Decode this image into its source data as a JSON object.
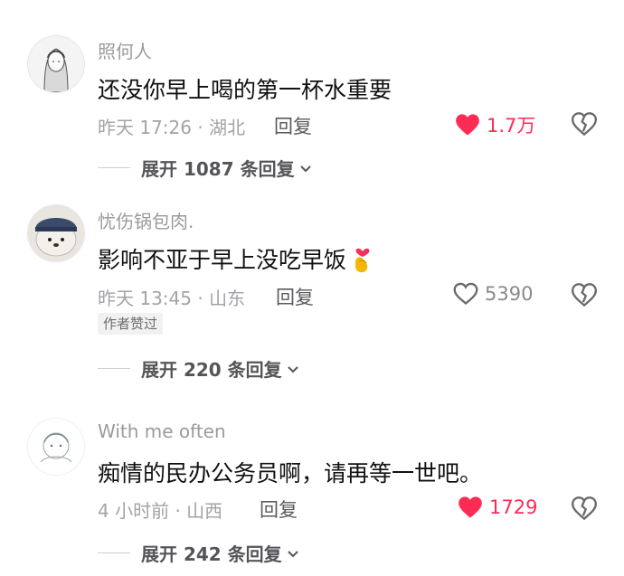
{
  "comments": [
    {
      "username": "照何人",
      "content": "还没你早上喝的第一杯水重要",
      "meta": "昨天 17:26 · 湖北",
      "reply_label": "回复",
      "likes": "1.7万",
      "liked": true,
      "expand": "展开 1087 条回复"
    },
    {
      "username": "忧伤锅包肉.",
      "content": "影响不亚于早上没吃早饭",
      "meta": "昨天 13:45 · 山东",
      "reply_label": "回复",
      "likes": "5390",
      "liked": false,
      "badge": "作者赞过",
      "expand": "展开 220 条回复"
    },
    {
      "username": "With me often",
      "content": "痴情的民办公务员啊，请再等一世吧。",
      "meta": "4 小时前 · 山西",
      "reply_label": "回复",
      "likes": "1729",
      "liked": true,
      "expand": "展开 242 条回复"
    }
  ],
  "colors": {
    "like_red": "#fe2c55",
    "muted": "#a3a3a8"
  },
  "icons": [
    "heart-icon",
    "broken-heart-icon",
    "chevron-down-icon",
    "finger-heart-emoji"
  ]
}
